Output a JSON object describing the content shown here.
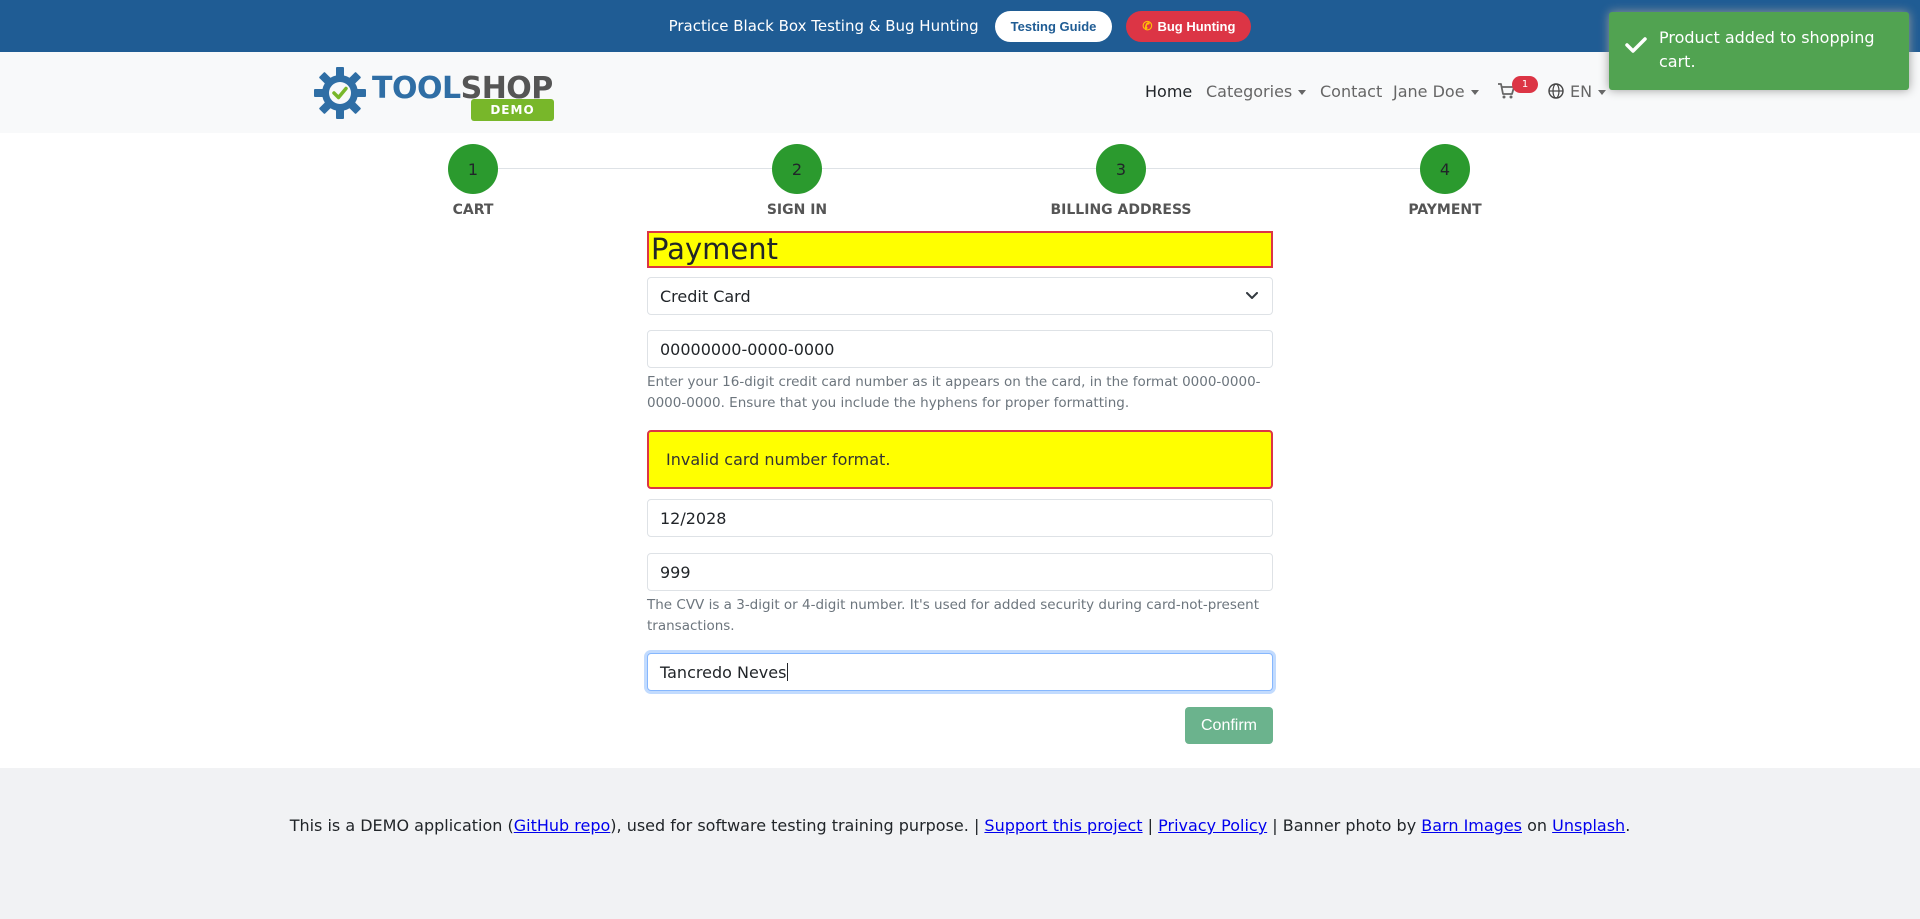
{
  "banner": {
    "text": "Practice Black Box Testing & Bug Hunting",
    "testing_guide": "Testing Guide",
    "bug_hunting": "Bug Hunting",
    "bg_color": "#1f5c94"
  },
  "logo": {
    "word_part1": "TOOL",
    "word_part2": "SHOP",
    "badge": "DEMO"
  },
  "nav": {
    "home": "Home",
    "categories": "Categories",
    "contact": "Contact",
    "user": "Jane Doe",
    "cart_count": "1",
    "language": "EN"
  },
  "toast": {
    "message": "Product added to shopping cart.",
    "color": "#51a351"
  },
  "steps": [
    {
      "number": "1",
      "label": "CART"
    },
    {
      "number": "2",
      "label": "SIGN IN"
    },
    {
      "number": "3",
      "label": "BILLING ADDRESS"
    },
    {
      "number": "4",
      "label": "PAYMENT"
    }
  ],
  "form": {
    "title": "Payment",
    "payment_method": "Credit Card",
    "card_number": "00000000-0000-0000",
    "card_help": "Enter your 16-digit credit card number as it appears on the card, in the format 0000-0000-0000-0000. Ensure that you include the hyphens for proper formatting.",
    "card_error": "Invalid card number format.",
    "expiration": "12/2028",
    "cvv": "999",
    "cvv_help": "The CVV is a 3-digit or 4-digit number. It's used for added security during card-not-present transactions.",
    "card_holder": "Tancredo Neves",
    "confirm": "Confirm"
  },
  "footer": {
    "part1": "This is a DEMO application (",
    "github": "GitHub repo",
    "part2": "), used for software testing training purpose. | ",
    "support": "Support this project",
    "sep1": " | ",
    "privacy": "Privacy Policy",
    "part3": " | Banner photo by ",
    "barn": "Barn Images",
    "part4": " on ",
    "unsplash": "Unsplash",
    "part5": "."
  },
  "colors": {
    "step_green": "#2b9a2e",
    "highlight_yellow": "#ffff00",
    "error_red": "#dc3545",
    "confirm_green": "#6bb38d"
  }
}
